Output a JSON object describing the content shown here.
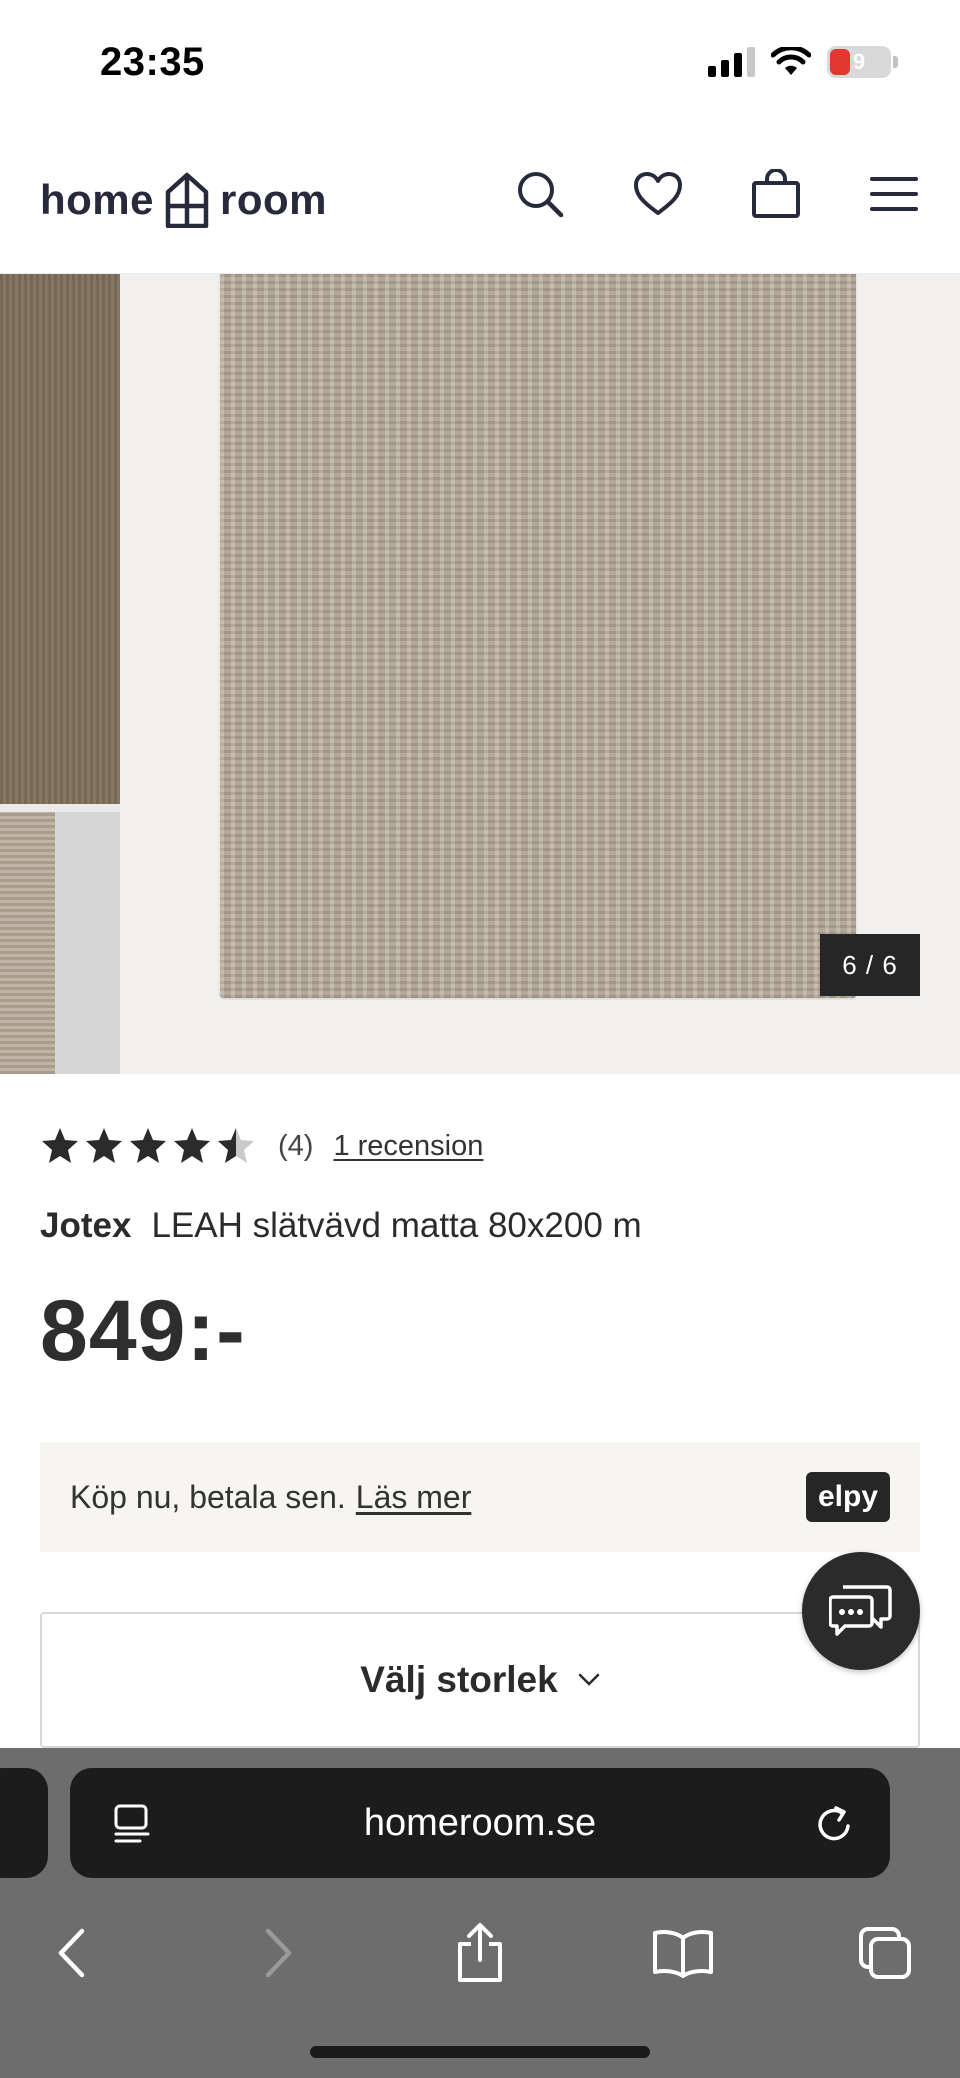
{
  "status_bar": {
    "time": "23:35",
    "battery_level": "9"
  },
  "header": {
    "logo_left": "home",
    "logo_right": "room",
    "icons": [
      "search-icon",
      "heart-icon",
      "bag-icon",
      "menu-icon"
    ]
  },
  "gallery": {
    "counter": "6 / 6"
  },
  "product": {
    "rating_value": 4.5,
    "rating_count": "(4)",
    "reviews_link": "1 recension",
    "brand": "Jotex",
    "title": "LEAH slätvävd matta 80x200 m",
    "price": "849:-"
  },
  "pay_later": {
    "text": "Köp nu, betala sen.",
    "link": "Läs mer",
    "provider": "elpy"
  },
  "size_select": {
    "label": "Välj storlek"
  },
  "browser": {
    "url": "homeroom.se"
  },
  "colors": {
    "brand_dark": "#262a3b",
    "text": "#2b2b2b",
    "chrome": "#6d6d6d"
  }
}
